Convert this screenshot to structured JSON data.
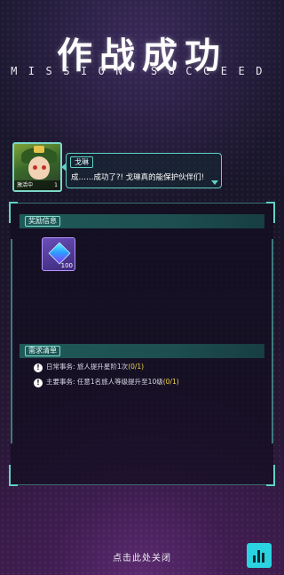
{
  "header": {
    "title": "作战成功",
    "subtitle": "MISSION SUCCEED"
  },
  "dialog": {
    "speaker_name": "戈琳",
    "nameplate": "激活中",
    "avatar_level": "1",
    "line": "成……成功了?! 戈琳真的能保护伙伴们!"
  },
  "rewards": {
    "header": "奖励信息",
    "items": [
      {
        "icon": "crystal-cube-icon",
        "quantity": "100"
      }
    ]
  },
  "requirements": {
    "header": "需求清单",
    "items": [
      {
        "text": "日常事务: 旅人提升星阶1次",
        "progress": "(0/1)"
      },
      {
        "text": "主要事务: 任意1名旅人等级提升至10级",
        "progress": "(0/1)"
      }
    ]
  },
  "footer": {
    "close_hint": "点击此处关闭",
    "stats_icon": "bar-chart-icon"
  },
  "colors": {
    "accent": "#5fd2c4",
    "button": "#2bd3e0",
    "progress": "#f1d64a"
  }
}
